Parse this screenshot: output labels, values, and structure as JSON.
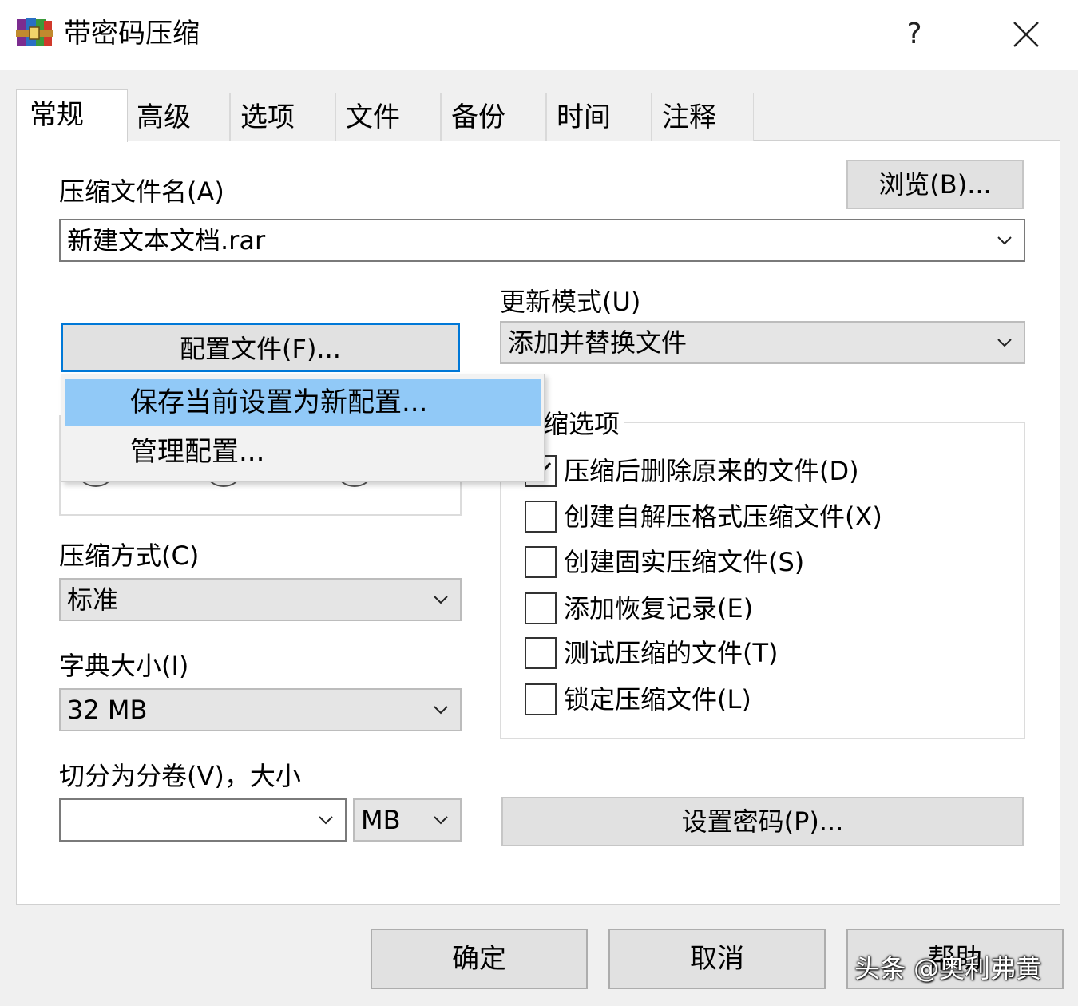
{
  "window": {
    "title": "带密码压缩",
    "help_label": "?",
    "icon": "winrar-books-icon"
  },
  "tabs": [
    {
      "label": "常规",
      "active": true
    },
    {
      "label": "高级"
    },
    {
      "label": "选项"
    },
    {
      "label": "文件"
    },
    {
      "label": "备份"
    },
    {
      "label": "时间"
    },
    {
      "label": "注释"
    }
  ],
  "archive_name": {
    "label": "压缩文件名(A)",
    "value": "新建文本文档.rar",
    "browse_label": "浏览(B)..."
  },
  "profiles": {
    "button_label": "配置文件(F)...",
    "menu_items": [
      "保存当前设置为新配置...",
      "管理配置..."
    ]
  },
  "update_mode": {
    "label": "更新模式(U)",
    "value": "添加并替换文件"
  },
  "archive_options": {
    "title_visible": "缩选项",
    "items": [
      {
        "label": "压缩后删除原来的文件(D)",
        "checked": true
      },
      {
        "label": "创建自解压格式压缩文件(X)",
        "checked": false
      },
      {
        "label": "创建固实压缩文件(S)",
        "checked": false
      },
      {
        "label": "添加恢复记录(E)",
        "checked": false
      },
      {
        "label": "测试压缩的文件(T)",
        "checked": false
      },
      {
        "label": "锁定压缩文件(L)",
        "checked": false
      }
    ]
  },
  "compression_method": {
    "label": "压缩方式(C)",
    "value": "标准"
  },
  "dictionary_size": {
    "label": "字典大小(I)",
    "value": "32 MB"
  },
  "split_volumes": {
    "label": "切分为分卷(V)，大小",
    "value": "",
    "unit": "MB"
  },
  "set_password_label": "设置密码(P)...",
  "footer": {
    "ok_label": "确定",
    "cancel_label": "取消",
    "help_label": "帮助"
  },
  "watermark": "头条 @奥利弗黄"
}
